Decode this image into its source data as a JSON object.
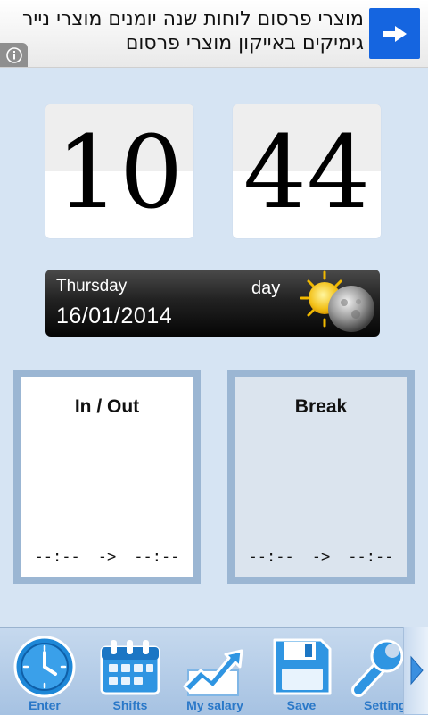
{
  "ad": {
    "line1": "מוצרי פרסום לוחות שנה יומנים מוצרי נייר",
    "line2": "גימיקים באייקון מוצרי פרסום"
  },
  "clock": {
    "hours": "10",
    "minutes": "44"
  },
  "date_bar": {
    "weekday": "Thursday",
    "date": "16/01/2014",
    "period": "day"
  },
  "panels": {
    "in_out": {
      "title": "In / Out",
      "start": "--:--",
      "arrow": "->",
      "end": "--:--"
    },
    "break": {
      "title": "Break",
      "start": "--:--",
      "arrow": "->",
      "end": "--:--"
    }
  },
  "toolbar": {
    "items": [
      {
        "label": "Enter",
        "icon": "clock-icon"
      },
      {
        "label": "Shifts",
        "icon": "calendar-icon"
      },
      {
        "label": "My salary",
        "icon": "chart-icon"
      },
      {
        "label": "Save",
        "icon": "floppy-icon"
      },
      {
        "label": "Settings",
        "icon": "wrench-icon"
      }
    ]
  },
  "colors": {
    "background": "#d6e4f3",
    "ad_arrow": "#1565e0",
    "toolbar_label": "#2a78c8",
    "panel_border": "#9bb6d3"
  }
}
